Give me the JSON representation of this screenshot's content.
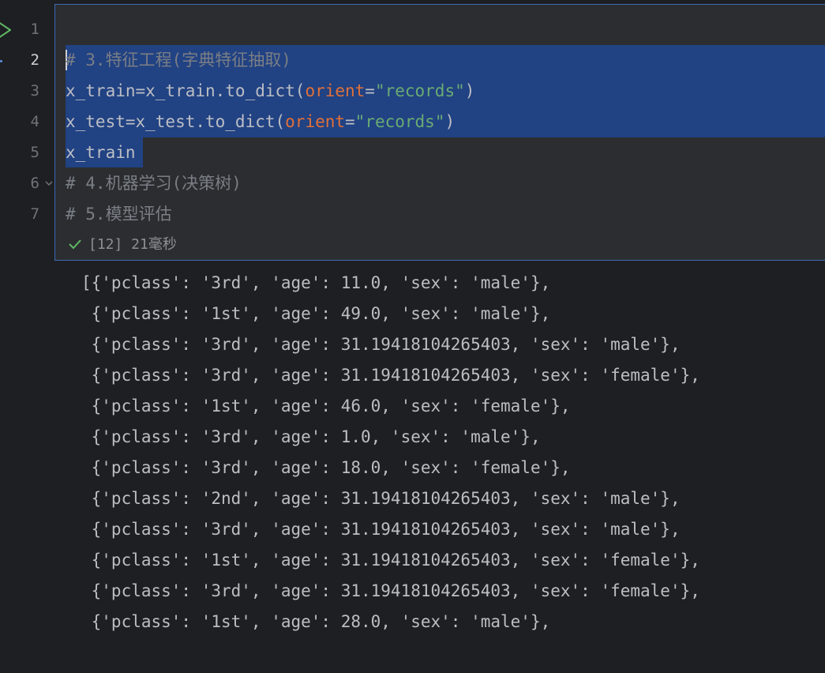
{
  "gutter": {
    "line_numbers": [
      "1",
      "2",
      "3",
      "4",
      "5",
      "6",
      "7"
    ],
    "current_line": "2"
  },
  "code": {
    "line2_comment": "# 3.特征工程(字典特征抽取)",
    "line3": {
      "prefix": "x_train=x_train.to_dict(",
      "param": "orient",
      "eq": "=",
      "string": "\"records\"",
      "suffix": ")"
    },
    "line4": {
      "prefix": "x_test=x_test.to_dict(",
      "param": "orient",
      "eq": "=",
      "string": "\"records\"",
      "suffix": ")"
    },
    "line5": "x_train",
    "line6_comment": "# 4.机器学习(决策树)",
    "line7_comment": "# 5.模型评估"
  },
  "status": {
    "text": "[12] 21毫秒"
  },
  "output": {
    "lines": [
      "[{'pclass': '3rd', 'age': 11.0, 'sex': 'male'},",
      " {'pclass': '1st', 'age': 49.0, 'sex': 'male'},",
      " {'pclass': '3rd', 'age': 31.19418104265403, 'sex': 'male'},",
      " {'pclass': '3rd', 'age': 31.19418104265403, 'sex': 'female'},",
      " {'pclass': '1st', 'age': 46.0, 'sex': 'female'},",
      " {'pclass': '3rd', 'age': 1.0, 'sex': 'male'},",
      " {'pclass': '3rd', 'age': 18.0, 'sex': 'female'},",
      " {'pclass': '2nd', 'age': 31.19418104265403, 'sex': 'male'},",
      " {'pclass': '3rd', 'age': 31.19418104265403, 'sex': 'male'},",
      " {'pclass': '1st', 'age': 31.19418104265403, 'sex': 'female'},",
      " {'pclass': '3rd', 'age': 31.19418104265403, 'sex': 'female'},",
      " {'pclass': '1st', 'age': 28.0, 'sex': 'male'},"
    ]
  },
  "colors": {
    "background": "#1e1f22",
    "cell_background": "#2b2d30",
    "cell_border": "#3d6ab8",
    "selection": "#214283",
    "comment": "#7a7e85",
    "param": "#e0703a",
    "string": "#6aab73",
    "text": "#bcbec4",
    "check": "#5fb865"
  },
  "icons": {
    "run": "run-cell-icon",
    "fold": "chevron-down-icon",
    "status": "check-icon"
  }
}
